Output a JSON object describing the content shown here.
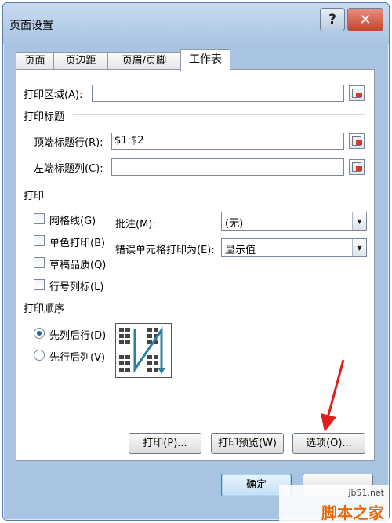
{
  "window": {
    "title": "页面设置",
    "help_label": "?",
    "close_label": "✕"
  },
  "tabs": [
    {
      "label": "页面"
    },
    {
      "label": "页边距"
    },
    {
      "label": "页眉/页脚"
    },
    {
      "label": "工作表",
      "active": true
    }
  ],
  "print_area": {
    "label": "打印区域(A):",
    "value": ""
  },
  "print_titles": {
    "heading": "打印标题",
    "rows_label": "顶端标题行(R):",
    "rows_value": "$1:$2",
    "cols_label": "左端标题列(C):",
    "cols_value": ""
  },
  "print": {
    "heading": "打印",
    "checkboxes": [
      {
        "label": "网格线(G)",
        "checked": false
      },
      {
        "label": "单色打印(B)",
        "checked": false
      },
      {
        "label": "草稿品质(Q)",
        "checked": false
      },
      {
        "label": "行号列标(L)",
        "checked": false
      }
    ],
    "comments_label": "批注(M):",
    "comments_value": "(无)",
    "errors_label": "错误单元格打印为(E):",
    "errors_value": "显示值"
  },
  "page_order": {
    "heading": "打印顺序",
    "options": [
      {
        "label": "先列后行(D)",
        "selected": true
      },
      {
        "label": "先行后列(V)",
        "selected": false
      }
    ]
  },
  "buttons": {
    "print": "打印(P)...",
    "preview": "打印预览(W)",
    "options": "选项(O)...",
    "ok": "确定"
  },
  "watermark": {
    "site": "jb51.net",
    "name": "脚本之家"
  },
  "colors": {
    "frame": "#a9c4e3",
    "annotation_arrow": "#e0201c",
    "ok_button": "#c2e0f4"
  }
}
